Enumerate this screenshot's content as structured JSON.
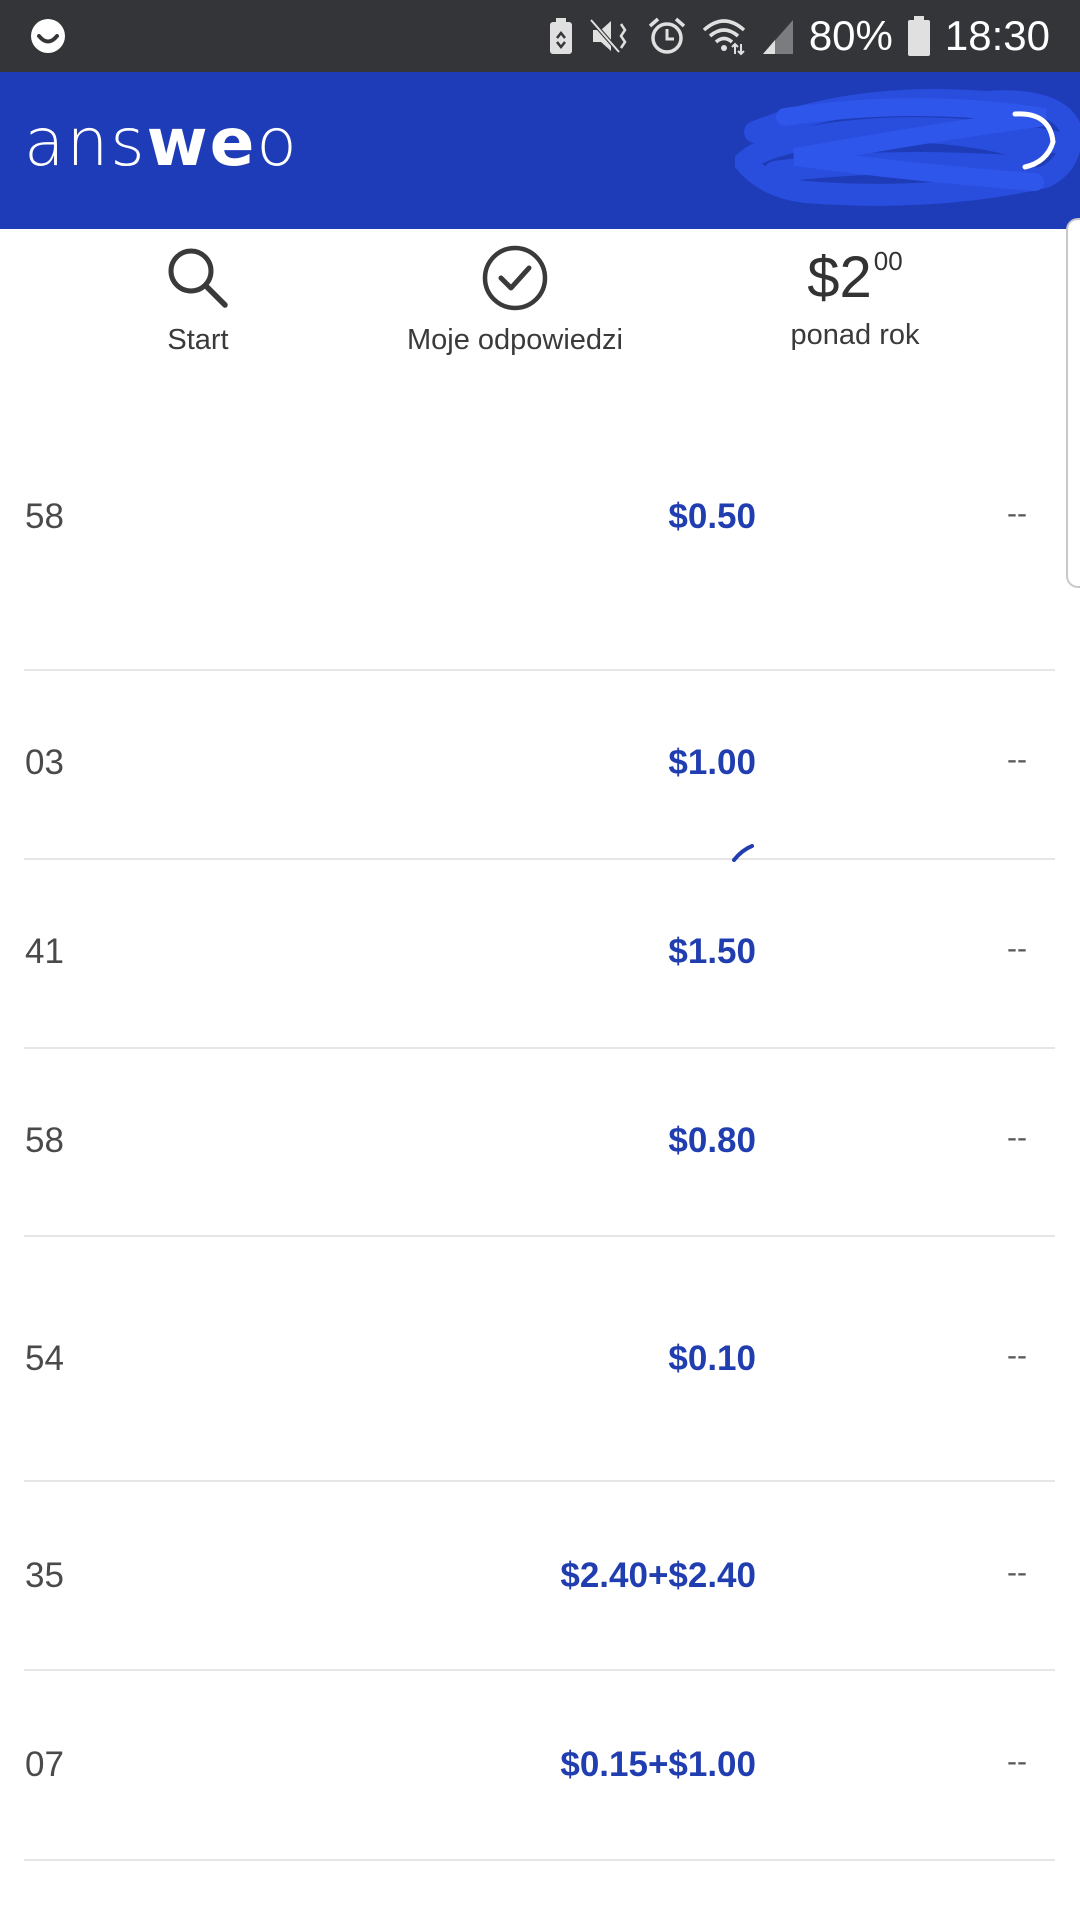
{
  "status_bar": {
    "battery_percent": "80%",
    "time": "18:30",
    "icons": [
      "app-notification-icon",
      "battery-saver-icon",
      "mute-icon",
      "alarm-icon",
      "wifi-icon",
      "signal-icon",
      "battery-icon"
    ]
  },
  "header": {
    "logo_light_1": "ans",
    "logo_bold": "we",
    "logo_light_2": "o",
    "brand_color": "#1e3cb7"
  },
  "nav": {
    "start_label": "Start",
    "answers_label": "Moje odpowiedzi",
    "earned_amount": "$2",
    "earned_cents": "00",
    "earned_label": "ponad rok"
  },
  "rows": [
    {
      "num": "58",
      "amount": "$0.50",
      "status": "--"
    },
    {
      "num": "03",
      "amount": "$1.00",
      "status": "--"
    },
    {
      "num": "41",
      "amount": "$1.50",
      "status": "--"
    },
    {
      "num": "58",
      "amount": "$0.80",
      "status": "--"
    },
    {
      "num": "54",
      "amount": "$0.10",
      "status": "--"
    },
    {
      "num": "35",
      "amount": "$2.40+$2.40",
      "status": "--"
    },
    {
      "num": "07",
      "amount": "$0.15+$1.00",
      "status": "--"
    }
  ],
  "colors": {
    "amount": "#213eb0",
    "status_bar_bg": "#333538",
    "divider": "#e6e6e6"
  }
}
